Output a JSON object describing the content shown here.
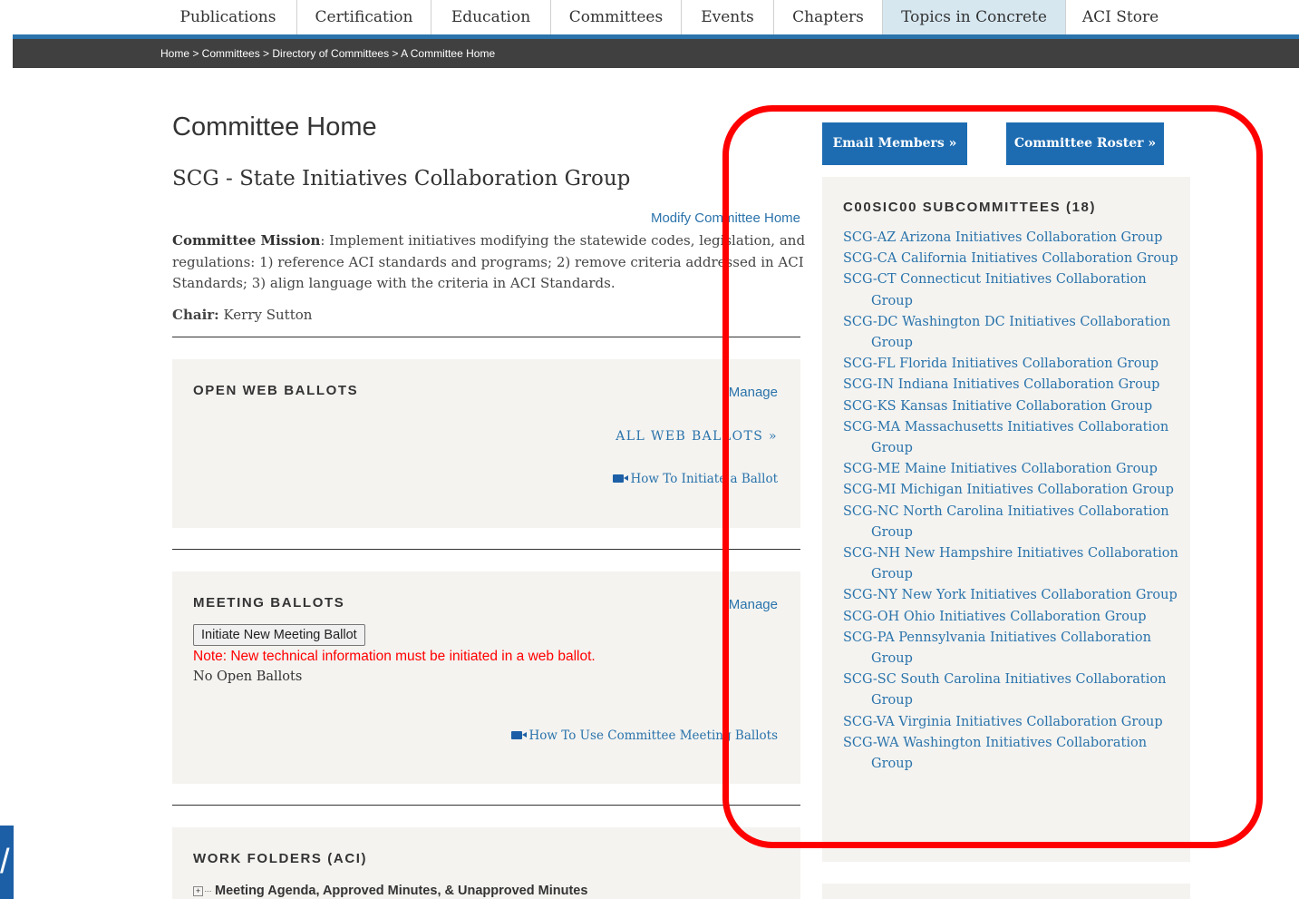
{
  "nav": {
    "items": [
      {
        "label": "Publications"
      },
      {
        "label": "Certification"
      },
      {
        "label": "Education"
      },
      {
        "label": "Committees"
      },
      {
        "label": "Events"
      },
      {
        "label": "Chapters"
      },
      {
        "label": "Topics in Concrete"
      },
      {
        "label": "ACI Store"
      }
    ]
  },
  "breadcrumb": "Home > Committees > Directory of Committees > A Committee Home",
  "page": {
    "title": "Committee Home",
    "committee_name": "SCG - State Initiatives Collaboration Group",
    "modify_link": "Modify Committee Home",
    "mission_label": "Committee Mission",
    "mission_text": ": Implement initiatives modifying the statewide codes, legislation, and regulations: 1) reference ACI standards and programs; 2) remove criteria addressed in ACI Standards; 3) align language with the criteria in ACI Standards.",
    "chair_label": "Chair:",
    "chair_name": " Kerry Sutton"
  },
  "web_ballots": {
    "title": "OPEN WEB BALLOTS",
    "manage": "Manage",
    "all_link": "ALL WEB BALLOTS »",
    "howto": "How To Initiate a Ballot"
  },
  "meeting_ballots": {
    "title": "MEETING BALLOTS",
    "manage": "Manage",
    "button": "Initiate New Meeting Ballot",
    "note": "Note: New technical information must be initiated in a web ballot.",
    "status": "No Open Ballots",
    "howto": "How To Use Committee Meeting Ballots"
  },
  "work_folders": {
    "title": "WORK FOLDERS (ACI)",
    "folder": "Meeting Agenda, Approved Minutes, & Unapproved Minutes"
  },
  "sidebar": {
    "email_button": "Email Members »",
    "roster_button": "Committee Roster »",
    "subcommittees_title": "C00SIC00 SUBCOMMITTEES (18)",
    "subcommittees": [
      "SCG-AZ Arizona Initiatives Collaboration Group",
      "SCG-CA California Initiatives Collaboration Group",
      "SCG-CT Connecticut Initiatives Collaboration Group",
      "SCG-DC Washington DC Initiatives Collaboration Group",
      "SCG-FL Florida Initiatives Collaboration Group",
      "SCG-IN Indiana Initiatives Collaboration Group",
      "SCG-KS Kansas Initiative Collaboration Group",
      "SCG-MA Massachusetts Initiatives Collaboration Group",
      "SCG-ME Maine Initiatives Collaboration Group",
      "SCG-MI Michigan Initiatives Collaboration Group",
      "SCG-NC North Carolina Initiatives Collaboration Group",
      "SCG-NH New Hampshire Initiatives Collaboration Group",
      "SCG-NY New York Initiatives Collaboration Group",
      "SCG-OH Ohio Initiatives Collaboration Group",
      "SCG-PA Pennsylvania Initiatives Collaboration Group",
      "SCG-SC South Carolina Initiatives Collaboration Group",
      "SCG-VA Virginia Initiatives Collaboration Group",
      "SCG-WA Washington Initiatives Collaboration Group"
    ]
  },
  "colors": {
    "accent": "#1d6cb2",
    "link": "#2a73ab",
    "highlight": "#ff0000"
  }
}
